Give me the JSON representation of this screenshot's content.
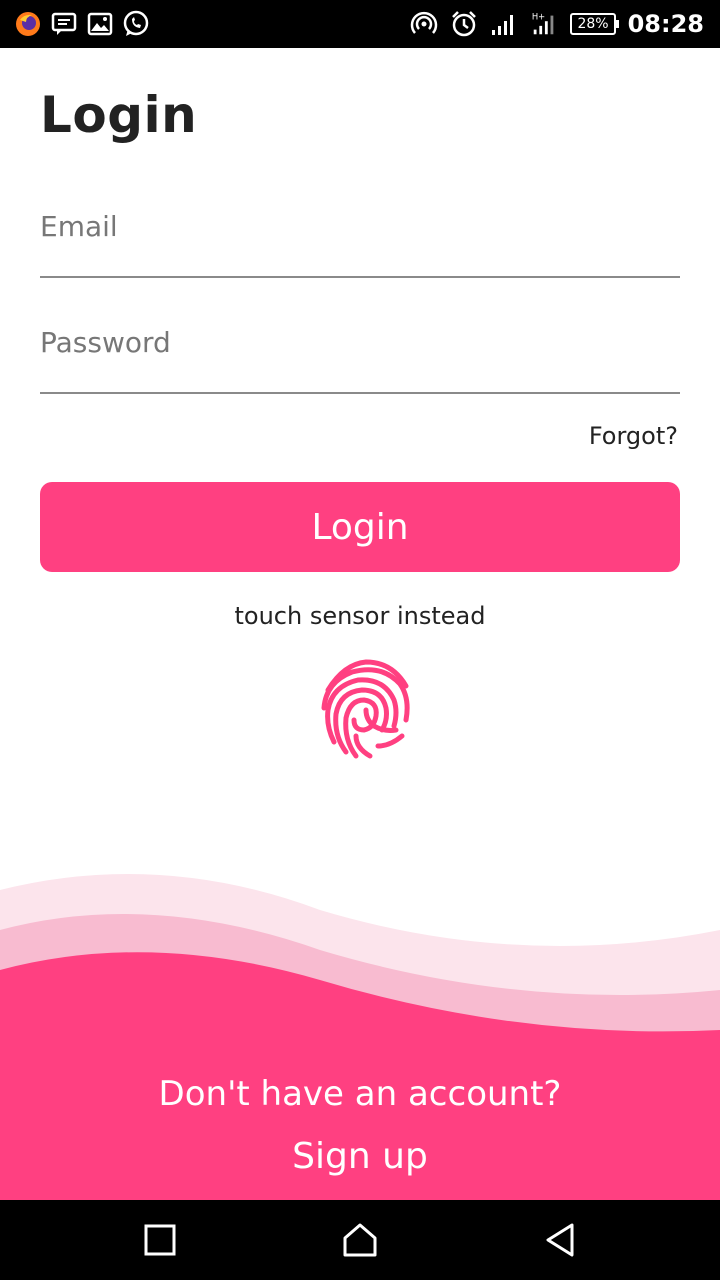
{
  "status_bar": {
    "time": "08:28",
    "battery": "28%",
    "left_icons": [
      "firefox-icon",
      "message-icon",
      "image-icon",
      "whatsapp-icon"
    ],
    "right_icons": [
      "hotspot-icon",
      "alarm-icon",
      "signal-icon",
      "signal-h-plus-icon",
      "battery-icon"
    ]
  },
  "login": {
    "title": "Login",
    "email_placeholder": "Email",
    "password_placeholder": "Password",
    "forgot": "Forgot?",
    "button": "Login",
    "touch_sensor": "touch sensor instead"
  },
  "footer": {
    "no_account": "Don't have an account?",
    "signup": "Sign up"
  },
  "colors": {
    "accent": "#ff4081",
    "wave_light": "#fce4ec",
    "wave_mid": "#f8bbd0"
  },
  "nav": [
    "recents-button",
    "home-button",
    "back-button"
  ]
}
